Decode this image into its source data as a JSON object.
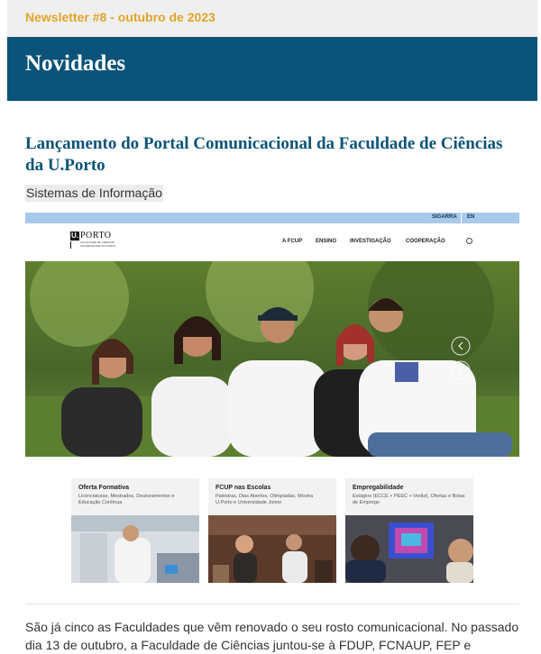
{
  "newsletter": {
    "issue_label": "Newsletter #8 - outubro de 2023"
  },
  "section": {
    "title": "Novidades"
  },
  "article": {
    "title": "Lançamento do Portal Comunicacional da Faculdade de Ciências da U.Porto",
    "category": "Sistemas de Informação",
    "body": "São já cinco as Faculdades que vêm renovado o seu rosto comunicacional. No passado dia 13 de outubro, a Faculdade de Ciências juntou-se à FDUP, FCNAUP, FEP e"
  },
  "portal_screenshot": {
    "top_links": [
      "SIGARRA",
      "EN"
    ],
    "logo_text": "PORTO",
    "logo_mark": "U.",
    "logo_sub": "FACULDADE DE CIÊNCIAS UNIVERSIDADE DO PORTO",
    "nav": [
      "A FCUP",
      "ENSINO",
      "INVESTIGAÇÃO",
      "COOPERAÇÃO"
    ],
    "cards": [
      {
        "title": "Oferta Formativa",
        "desc": "Licenciaturas, Mestrados, Doutoramentos e Educação Contínua"
      },
      {
        "title": "FCUP nas Escolas",
        "desc": "Palestras, Dias Abertos, Olimpíadas, Mostra U.Porto e Universidade Júnior"
      },
      {
        "title": "Empregabilidade",
        "desc": "Estágios (ECCE + PEEC + Verão), Ofertas e Bolsa de Emprego"
      }
    ]
  },
  "colors": {
    "accent": "#e0a52a",
    "brand": "#0b5378"
  },
  "icons": [
    "search-icon",
    "carousel-prev-icon",
    "carousel-next-icon"
  ]
}
